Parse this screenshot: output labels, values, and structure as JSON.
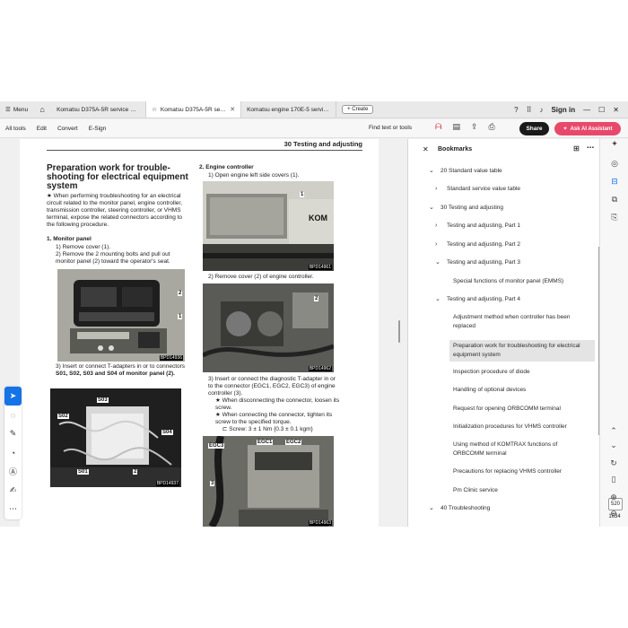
{
  "tabbar": {
    "menu_label": "Menu",
    "tabs": [
      {
        "label": "Komatsu D375A-5R service man..."
      },
      {
        "label": "Komatsu D375A-5R serv..."
      },
      {
        "label": "Komatsu engine 170E-5 service ..."
      }
    ],
    "create_label": "Create",
    "signin_label": "Sign in"
  },
  "toolbar": {
    "menus": [
      "All tools",
      "Edit",
      "Convert",
      "E-Sign"
    ],
    "find_label": "Find text or tools",
    "share_label": "Share",
    "ai_label": "Ask AI Assistant"
  },
  "doc": {
    "header": "30 Testing and adjusting",
    "title": "Preparation work for trouble-shooting for electrical equipment system",
    "intro": "When performing troubleshooting for an electrical circuit related to the monitor panel, engine controller, transmission controller, steering controller, or VHMS terminal, expose the related connectors according to the following procedure.",
    "s1_heading": "1.  Monitor panel",
    "s1_step1": "1)  Remove cover (1).",
    "s1_step2": "2)  Remove the 2 mounting bolts and pull out monitor panel (2) toward the operator's seat.",
    "s1_step3a": "3)  Insert or connect T-adapters in or to connectors",
    "s1_step3b": "S01, S02, S03 and S04 of monitor panel (2).",
    "s2_heading": "2.  Engine controller",
    "s2_step1": "1)  Open engine left side covers (1).",
    "s2_step2": "2)  Remove cover (2) of engine controller.",
    "s2_step3": "3)  Insert or connect the diagnostic T-adapter in or to the connector (EGC1, EGC2, EGC3) of engine controller (3).",
    "s2_star1": "When disconnecting the connector, loosen its screw.",
    "s2_star2": "When connecting the connector, tighten its screw to the specified torque.",
    "s2_torque": "Screw: 3 ± 1 Nm {0.3 ± 0.1 kgm}",
    "photos": {
      "p1_code": "BPD14936",
      "p2_code": "BPD14937",
      "p3_code": "BPD14961",
      "p4_code": "BPD14962",
      "p5_code": "BPD14963",
      "p1_labels": [
        "2",
        "1"
      ],
      "p2_labels": [
        "S03",
        "S02",
        "S04",
        "S01",
        "2"
      ],
      "p3_labels": [
        "1",
        "KOM"
      ],
      "p4_labels": [
        "2"
      ],
      "p5_labels": [
        "EGC3",
        "EGC1",
        "EGC2",
        "3"
      ]
    }
  },
  "bookmarks": {
    "title": "Bookmarks",
    "items": [
      {
        "label": "20 Standard value table",
        "chev": "v"
      },
      {
        "label": "Standard service value table",
        "chev": ">"
      },
      {
        "label": "30 Testing and adjusting",
        "chev": "v"
      },
      {
        "label": "Testing and adjusting, Part 1",
        "chev": ">"
      },
      {
        "label": "Testing and adjusting, Part 2",
        "chev": ">"
      },
      {
        "label": "Testing and adjusting, Part 3",
        "chev": "v"
      },
      {
        "label": "Special functions of monitor panel (EMMS)",
        "chev": ""
      },
      {
        "label": "Testing and adjusting, Part 4",
        "chev": "v"
      },
      {
        "label": "Adjustment method when controller has been replaced",
        "chev": ""
      },
      {
        "label": "Preparation work for troubleshooting for electrical equipment system",
        "chev": ""
      },
      {
        "label": "Inspection procedure of diode",
        "chev": ""
      },
      {
        "label": "Handling of optional devices",
        "chev": ""
      },
      {
        "label": "Request for opening ORBCOMM terminal",
        "chev": ""
      },
      {
        "label": "Initialization procedures for VHMS controller",
        "chev": ""
      },
      {
        "label": "Using method of KOMTRAX functions of ORBCOMM terminal",
        "chev": ""
      },
      {
        "label": "Precautions for replacing VHMS controller",
        "chev": ""
      },
      {
        "label": "Pm Clinic service",
        "chev": ""
      },
      {
        "label": "40 Troubleshooting",
        "chev": "v"
      }
    ]
  },
  "pager": {
    "current": "520",
    "total": "1634"
  },
  "icons": {
    "menu": "hamburger-icon",
    "home": "home-icon",
    "bookmark_star": "star-icon",
    "help": "help-icon",
    "bell": "bell-icon",
    "minimize": "minimize-icon",
    "maximize": "maximize-icon",
    "close": "close-icon"
  },
  "colors": {
    "accent": "#1473e6",
    "ai": "#e8496a",
    "share": "#1a1a1a"
  }
}
